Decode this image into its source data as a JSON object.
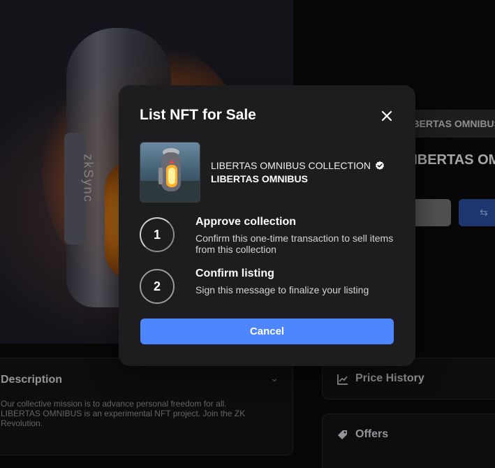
{
  "background": {
    "collection_pill": "LIBERTAS OMNIBUS COLLECTION",
    "nft_title": "LIBERTAS OMNIBUS",
    "hero_vertical_text": "zkSync",
    "description": {
      "title": "Description",
      "text": "Our collective mission is to advance personal freedom for all. LIBERTAS OMNIBUS is an experimental NFT project. Join the ZK Revolution."
    },
    "price_history_label": "Price History",
    "offers_label": "Offers"
  },
  "modal": {
    "title": "List NFT for Sale",
    "close_icon": "close-icon",
    "nft": {
      "collection": "LIBERTAS OMNIBUS COLLECTION",
      "name": "LIBERTAS OMNIBUS",
      "verified_icon": "verified-badge-icon"
    },
    "steps": [
      {
        "number": "1",
        "title": "Approve collection",
        "description": "Confirm this one-time transaction to sell items from this collection"
      },
      {
        "number": "2",
        "title": "Confirm listing",
        "description": "Sign this message to finalize your listing"
      }
    ],
    "cancel_label": "Cancel"
  },
  "colors": {
    "accent": "#4e86ff",
    "modal_bg": "#1d1d1f",
    "page_bg": "#0b0b0c"
  }
}
